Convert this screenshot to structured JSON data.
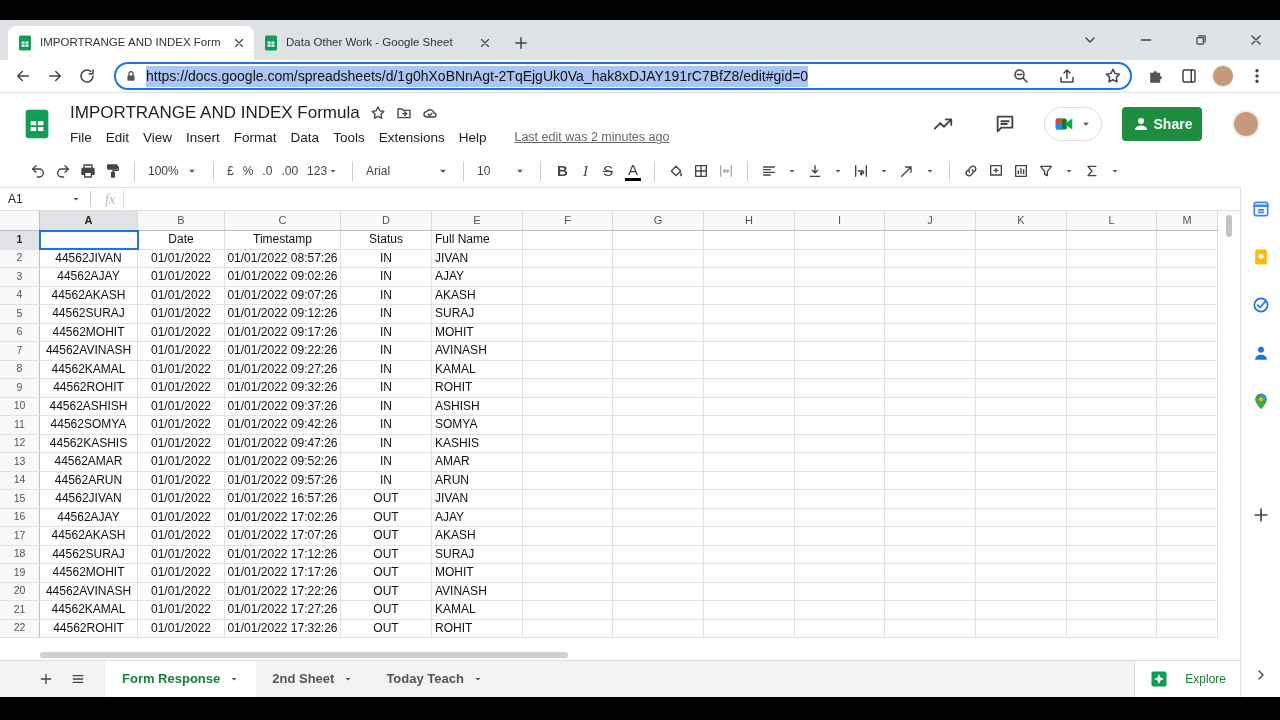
{
  "browser": {
    "tabs": [
      {
        "title": "IMPORTRANGE AND INDEX Form",
        "selected": true
      },
      {
        "title": "Data Other Work - Google Sheet",
        "selected": false
      }
    ],
    "url_host": "https://docs.google.com",
    "url_path": "/spreadsheets/d/1g0hXoBNnAgt-2TqEjgUk0Va_hak8xDJAY191rC7BfZ8/edit#gid=0"
  },
  "doc": {
    "title": "IMPORTRANGE AND INDEX Formula",
    "menu": [
      "File",
      "Edit",
      "View",
      "Insert",
      "Format",
      "Data",
      "Tools",
      "Extensions",
      "Help"
    ],
    "last_edit": "Last edit was 2 minutes ago",
    "share": "Share"
  },
  "toolbar": {
    "zoom": "100%",
    "currency": "£",
    "percent": "%",
    "decrease_decimal": ".0",
    "increase_decimal": ".00",
    "more_formats": "123",
    "font": "Arial",
    "font_size": "10",
    "bold": "B",
    "italic": "I",
    "strikethrough": "S",
    "text_color": "A"
  },
  "formula_bar": {
    "name_box": "A1",
    "fx": "fx"
  },
  "columns": [
    {
      "label": "A",
      "selected": true
    },
    {
      "label": "B",
      "selected": false
    },
    {
      "label": "C",
      "selected": false
    },
    {
      "label": "D",
      "selected": false
    },
    {
      "label": "E",
      "selected": false
    },
    {
      "label": "F",
      "selected": false
    },
    {
      "label": "G",
      "selected": false
    },
    {
      "label": "H",
      "selected": false
    },
    {
      "label": "I",
      "selected": false
    },
    {
      "label": "J",
      "selected": false
    },
    {
      "label": "K",
      "selected": false
    },
    {
      "label": "L",
      "selected": false
    },
    {
      "label": "M",
      "selected": false
    }
  ],
  "rows": [
    {
      "number": "1",
      "selected": true,
      "cells": [
        "",
        "Date",
        "Timestamp",
        "Status",
        "Full Name"
      ]
    },
    {
      "number": "2",
      "selected": false,
      "cells": [
        "44562JIVAN",
        "01/01/2022",
        "01/01/2022 08:57:26",
        "IN",
        "JIVAN"
      ]
    },
    {
      "number": "3",
      "selected": false,
      "cells": [
        "44562AJAY",
        "01/01/2022",
        "01/01/2022 09:02:26",
        "IN",
        "AJAY"
      ]
    },
    {
      "number": "4",
      "selected": false,
      "cells": [
        "44562AKASH",
        "01/01/2022",
        "01/01/2022 09:07:26",
        "IN",
        "AKASH"
      ]
    },
    {
      "number": "5",
      "selected": false,
      "cells": [
        "44562SURAJ",
        "01/01/2022",
        "01/01/2022 09:12:26",
        "IN",
        "SURAJ"
      ]
    },
    {
      "number": "6",
      "selected": false,
      "cells": [
        "44562MOHIT",
        "01/01/2022",
        "01/01/2022 09:17:26",
        "IN",
        "MOHIT"
      ]
    },
    {
      "number": "7",
      "selected": false,
      "cells": [
        "44562AVINASH",
        "01/01/2022",
        "01/01/2022 09:22:26",
        "IN",
        "AVINASH"
      ]
    },
    {
      "number": "8",
      "selected": false,
      "cells": [
        "44562KAMAL",
        "01/01/2022",
        "01/01/2022 09:27:26",
        "IN",
        "KAMAL"
      ]
    },
    {
      "number": "9",
      "selected": false,
      "cells": [
        "44562ROHIT",
        "01/01/2022",
        "01/01/2022 09:32:26",
        "IN",
        "ROHIT"
      ]
    },
    {
      "number": "10",
      "selected": false,
      "cells": [
        "44562ASHISH",
        "01/01/2022",
        "01/01/2022 09:37:26",
        "IN",
        "ASHISH"
      ]
    },
    {
      "number": "11",
      "selected": false,
      "cells": [
        "44562SOMYA",
        "01/01/2022",
        "01/01/2022 09:42:26",
        "IN",
        "SOMYA"
      ]
    },
    {
      "number": "12",
      "selected": false,
      "cells": [
        "44562KASHIS",
        "01/01/2022",
        "01/01/2022 09:47:26",
        "IN",
        "KASHIS"
      ]
    },
    {
      "number": "13",
      "selected": false,
      "cells": [
        "44562AMAR",
        "01/01/2022",
        "01/01/2022 09:52:26",
        "IN",
        "AMAR"
      ]
    },
    {
      "number": "14",
      "selected": false,
      "cells": [
        "44562ARUN",
        "01/01/2022",
        "01/01/2022 09:57:26",
        "IN",
        "ARUN"
      ]
    },
    {
      "number": "15",
      "selected": false,
      "cells": [
        "44562JIVAN",
        "01/01/2022",
        "01/01/2022 16:57:26",
        "OUT",
        "JIVAN"
      ]
    },
    {
      "number": "16",
      "selected": false,
      "cells": [
        "44562AJAY",
        "01/01/2022",
        "01/01/2022 17:02:26",
        "OUT",
        "AJAY"
      ]
    },
    {
      "number": "17",
      "selected": false,
      "cells": [
        "44562AKASH",
        "01/01/2022",
        "01/01/2022 17:07:26",
        "OUT",
        "AKASH"
      ]
    },
    {
      "number": "18",
      "selected": false,
      "cells": [
        "44562SURAJ",
        "01/01/2022",
        "01/01/2022 17:12:26",
        "OUT",
        "SURAJ"
      ]
    },
    {
      "number": "19",
      "selected": false,
      "cells": [
        "44562MOHIT",
        "01/01/2022",
        "01/01/2022 17:17:26",
        "OUT",
        "MOHIT"
      ]
    },
    {
      "number": "20",
      "selected": false,
      "cells": [
        "44562AVINASH",
        "01/01/2022",
        "01/01/2022 17:22:26",
        "OUT",
        "AVINASH"
      ]
    },
    {
      "number": "21",
      "selected": false,
      "cells": [
        "44562KAMAL",
        "01/01/2022",
        "01/01/2022 17:27:26",
        "OUT",
        "KAMAL"
      ]
    },
    {
      "number": "22",
      "selected": false,
      "cells": [
        "44562ROHIT",
        "01/01/2022",
        "01/01/2022 17:32:26",
        "OUT",
        "ROHIT"
      ]
    }
  ],
  "sheet_tabs": [
    {
      "label": "Form Response",
      "selected": true
    },
    {
      "label": "2nd Sheet",
      "selected": false
    },
    {
      "label": "Today Teach",
      "selected": false
    }
  ],
  "explore": "Explore"
}
